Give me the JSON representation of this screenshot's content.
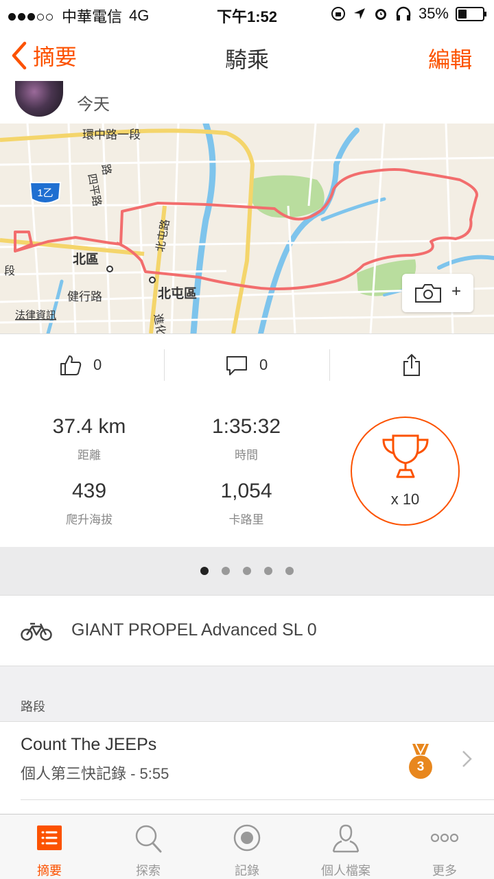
{
  "status": {
    "carrier": "中華電信",
    "network": "4G",
    "time": "下午1:52",
    "battery": "35%"
  },
  "nav": {
    "back_label": "摘要",
    "title": "騎乘",
    "edit_label": "編輯"
  },
  "activity": {
    "date": "今天"
  },
  "map": {
    "labels": {
      "road1": "環中路一段",
      "road2": "路",
      "road3": "四平路",
      "road4": "北屯路",
      "badge": "1乙",
      "district1": "北區",
      "district2": "北屯區",
      "road5": "健行路",
      "road6": "段",
      "road7": "進化",
      "legal": "法律資訊"
    },
    "route_color": "#f26d6d"
  },
  "social": {
    "likes": "0",
    "comments": "0"
  },
  "stats": {
    "distance": {
      "value": "37.4 km",
      "label": "距離"
    },
    "time": {
      "value": "1:35:32",
      "label": "時間"
    },
    "elevation": {
      "value": "439",
      "label": "爬升海拔"
    },
    "calories": {
      "value": "1,054",
      "label": "卡路里"
    },
    "achievements": "x 10"
  },
  "pager": {
    "count": 5,
    "active": 0
  },
  "gear": {
    "bike": "GIANT PROPEL Advanced SL 0"
  },
  "segments": {
    "header": "路段",
    "items": [
      {
        "name": "Count The JEEPs",
        "detail": "個人第三快記錄 - 5:55",
        "rank": "3"
      }
    ]
  },
  "tabs": [
    {
      "label": "摘要",
      "icon": "list-icon",
      "active": true
    },
    {
      "label": "探索",
      "icon": "search-icon",
      "active": false
    },
    {
      "label": "記錄",
      "icon": "record-icon",
      "active": false
    },
    {
      "label": "個人檔案",
      "icon": "profile-icon",
      "active": false
    },
    {
      "label": "更多",
      "icon": "more-icon",
      "active": false
    }
  ],
  "colors": {
    "accent": "#fc5200",
    "medal": "#e8871e"
  }
}
